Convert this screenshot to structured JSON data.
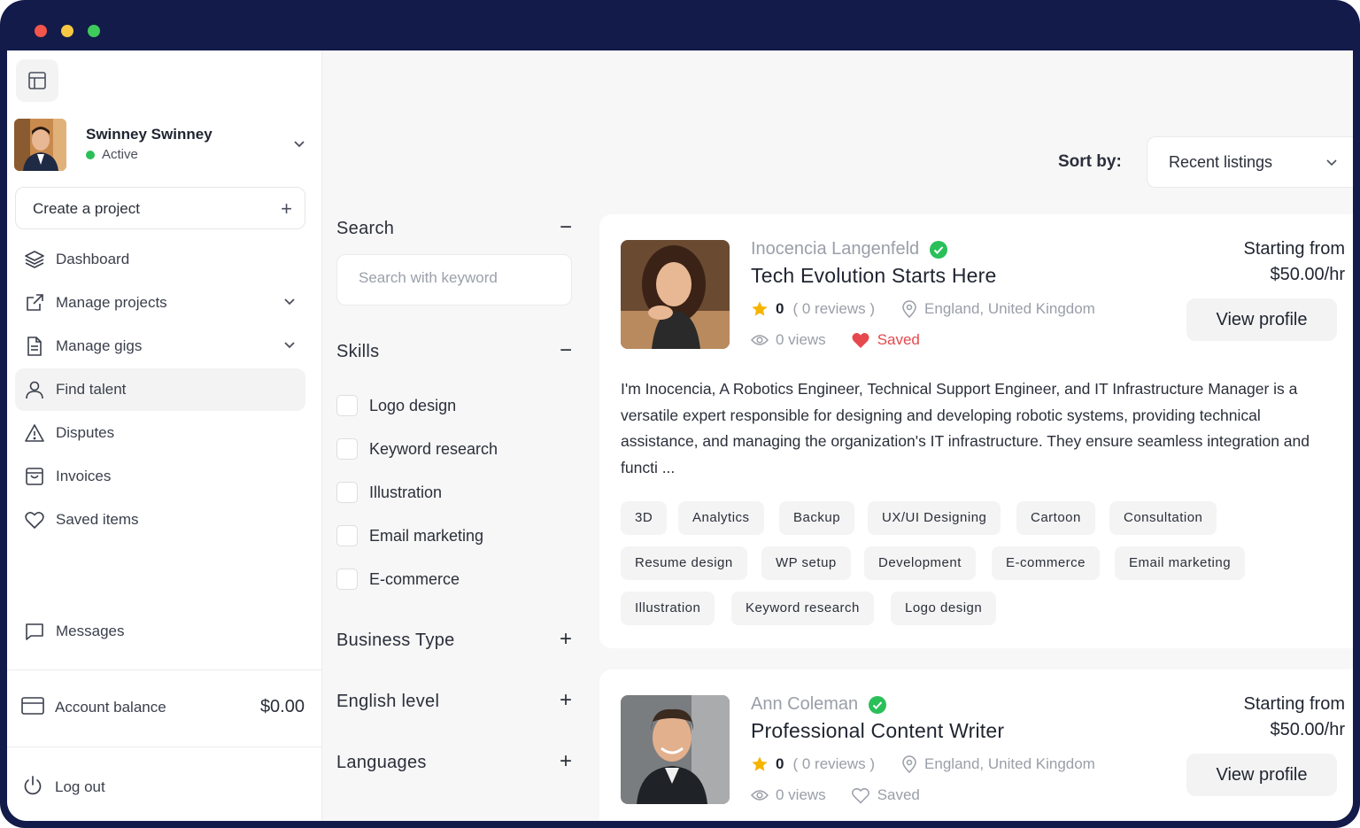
{
  "user": {
    "name": "Swinney Swinney",
    "status": "Active"
  },
  "sidebar": {
    "create_label": "Create a project",
    "items": [
      {
        "label": "Dashboard",
        "icon": "layers-icon"
      },
      {
        "label": "Manage projects",
        "icon": "external-link-icon"
      },
      {
        "label": "Manage gigs",
        "icon": "document-icon"
      },
      {
        "label": "Find talent",
        "icon": "user-icon"
      },
      {
        "label": "Disputes",
        "icon": "warning-icon"
      },
      {
        "label": "Invoices",
        "icon": "shopping-bag-icon"
      },
      {
        "label": "Saved items",
        "icon": "heart-icon"
      },
      {
        "label": "Messages",
        "icon": "message-icon"
      }
    ],
    "balance_label": "Account balance",
    "balance_value": "$0.00",
    "logout_label": "Log out"
  },
  "filters": {
    "search_title": "Search",
    "search_placeholder": "Search with keyword",
    "skills_title": "Skills",
    "skills": [
      "Logo design",
      "Keyword research",
      "Illustration",
      "Email marketing",
      "E-commerce"
    ],
    "business_type": "Business Type",
    "english_level": "English level",
    "languages": "Languages"
  },
  "sort": {
    "label": "Sort by:",
    "value": "Recent listings"
  },
  "cards": [
    {
      "name": "Inocencia Langenfeld",
      "title": "Tech Evolution Starts Here",
      "rating": "0",
      "reviews": "( 0 reviews )",
      "location": "England, United Kingdom",
      "views": "0 views",
      "saved": "Saved",
      "saved_color": "#e5484d",
      "price_label": "Starting from",
      "price": "$50.00/hr",
      "view_label": "View profile",
      "description": "I'm Inocencia, A Robotics Engineer, Technical Support Engineer, and IT Infrastructure Manager is a versatile expert responsible for designing and developing robotic systems, providing technical assistance, and managing the organization's IT infrastructure. They ensure seamless integration and functi ...",
      "tags": [
        "3D",
        "Analytics",
        "Backup",
        "UX/UI Designing",
        "Cartoon",
        "Consultation",
        "Resume design",
        "WP setup",
        "Development",
        "E-commerce",
        "Email marketing",
        "Illustration",
        "Keyword research",
        "Logo design"
      ]
    },
    {
      "name": "Ann Coleman",
      "title": "Professional Content Writer",
      "rating": "0",
      "reviews": "( 0 reviews )",
      "location": "England, United Kingdom",
      "views": "0 views",
      "saved": "Saved",
      "saved_color": "#9a9ea8",
      "price_label": "Starting from",
      "price": "$50.00/hr",
      "view_label": "View profile"
    }
  ],
  "colors": {
    "frame": "#131b4a",
    "verified": "#2bbf5a",
    "star": "#f5b400",
    "active": "#2bbf5a"
  }
}
